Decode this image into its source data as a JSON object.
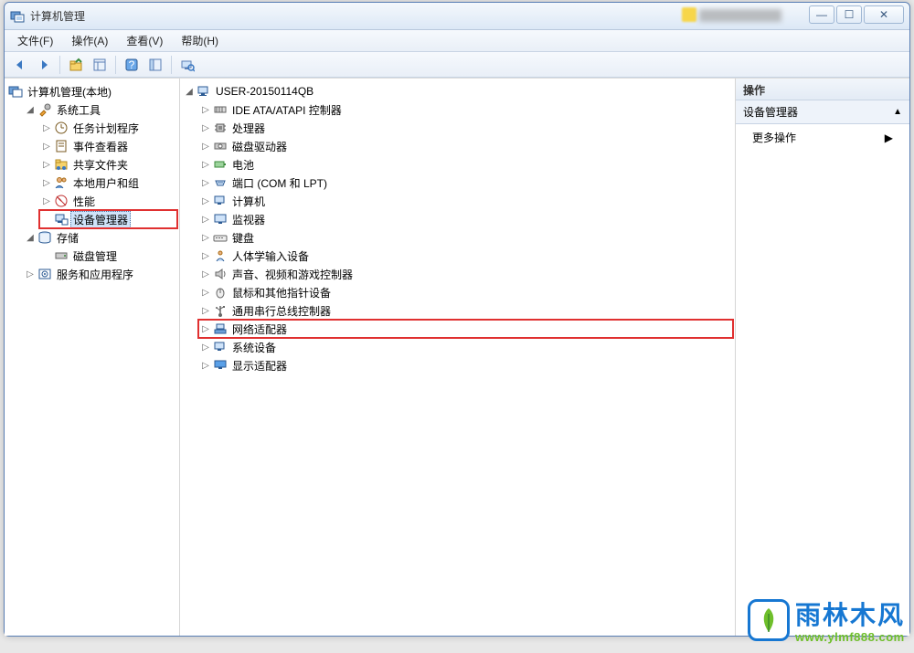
{
  "window": {
    "title": "计算机管理",
    "buttons": {
      "min": "—",
      "max": "☐",
      "close": "✕"
    }
  },
  "menu": {
    "file": "文件(F)",
    "action": "操作(A)",
    "view": "查看(V)",
    "help": "帮助(H)"
  },
  "left_tree": {
    "root": "计算机管理(本地)",
    "system_tools": "系统工具",
    "task_scheduler": "任务计划程序",
    "event_viewer": "事件查看器",
    "shared_folders": "共享文件夹",
    "local_users": "本地用户和组",
    "performance": "性能",
    "device_manager": "设备管理器",
    "storage": "存储",
    "disk_mgmt": "磁盘管理",
    "services_apps": "服务和应用程序"
  },
  "center_tree": {
    "root": "USER-20150114QB",
    "ide": "IDE ATA/ATAPI 控制器",
    "cpu": "处理器",
    "disk_drives": "磁盘驱动器",
    "battery": "电池",
    "ports": "端口 (COM 和 LPT)",
    "computer": "计算机",
    "monitor": "监视器",
    "keyboard": "键盘",
    "hid": "人体学输入设备",
    "sound": "声音、视频和游戏控制器",
    "mouse": "鼠标和其他指针设备",
    "usb": "通用串行总线控制器",
    "network": "网络适配器",
    "system_devices": "系统设备",
    "display": "显示适配器"
  },
  "right": {
    "header": "操作",
    "section": "设备管理器",
    "more": "更多操作"
  },
  "logo": {
    "cn": "雨林木风",
    "en": "www.ylmf888.com"
  }
}
